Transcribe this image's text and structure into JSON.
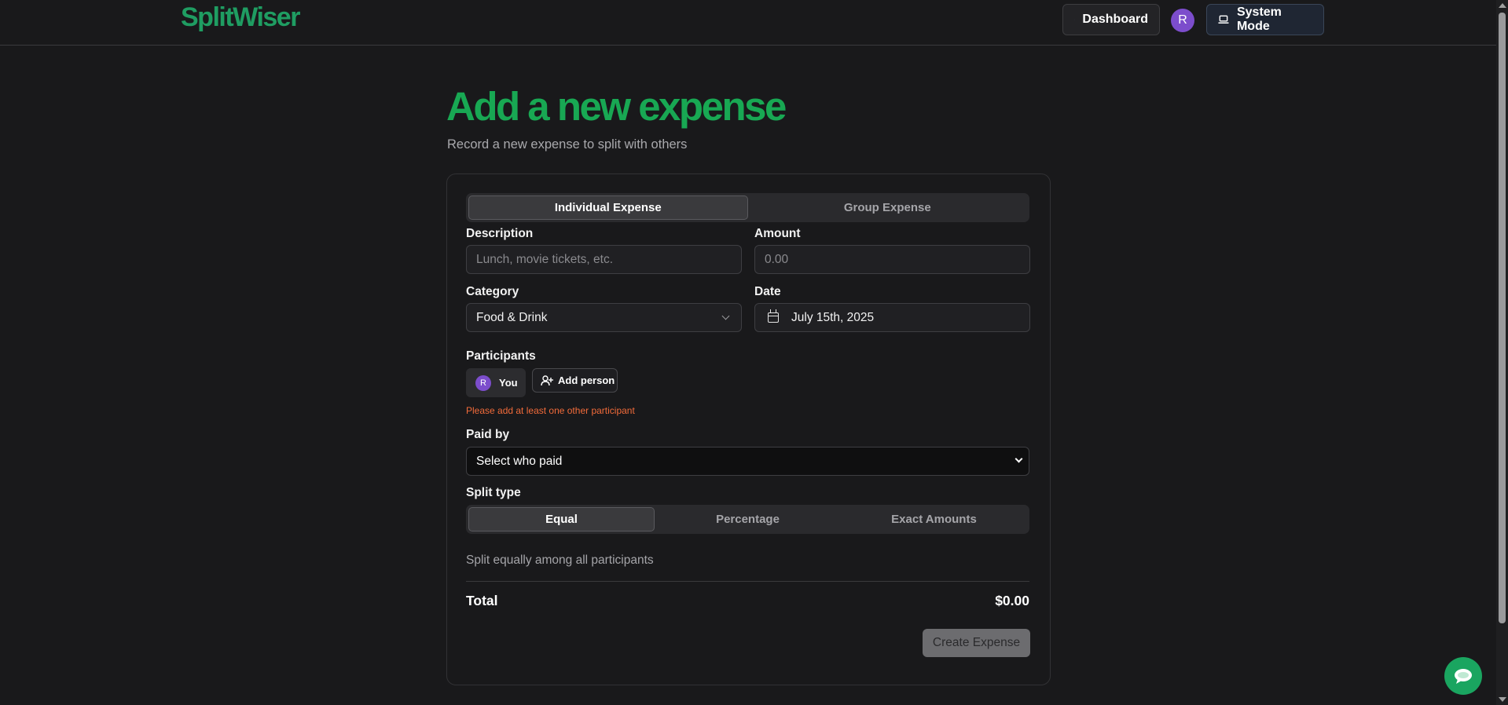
{
  "header": {
    "logo": "SplitWiser",
    "dashboard_label": "Dashboard",
    "avatar_initial": "R",
    "system_mode_label": "System Mode"
  },
  "page": {
    "title": "Add a new expense",
    "subtitle": "Record a new expense to split with others"
  },
  "tabs": {
    "individual": "Individual Expense",
    "group": "Group Expense",
    "active": "individual"
  },
  "form": {
    "description_label": "Description",
    "description_placeholder": "Lunch, movie tickets, etc.",
    "amount_label": "Amount",
    "amount_placeholder": "0.00",
    "category_label": "Category",
    "category_value": "Food & Drink",
    "date_label": "Date",
    "date_value": "July 15th, 2025",
    "participants_label": "Participants",
    "participant_you_initial": "R",
    "participant_you_label": "You",
    "add_person_label": "Add person",
    "participants_error": "Please add at least one other participant",
    "paid_by_label": "Paid by",
    "paid_by_value": "Select who paid",
    "split_type_label": "Split type",
    "split_options": [
      "Equal",
      "Percentage",
      "Exact Amounts"
    ],
    "split_active": "Equal",
    "split_description": "Split equally among all participants",
    "total_label": "Total",
    "total_value": "$0.00",
    "submit_label": "Create Expense"
  },
  "colors": {
    "brand_green": "#18a853",
    "avatar_purple": "#7c4dcc",
    "error_orange": "#f26b3a",
    "background": "#19191b"
  },
  "icons": {
    "dashboard": "grid-icon",
    "system_mode": "laptop-icon",
    "date": "calendar-icon",
    "category": "chevron-down-icon",
    "add_person": "user-plus-icon",
    "chat": "chat-bubble-icon"
  }
}
